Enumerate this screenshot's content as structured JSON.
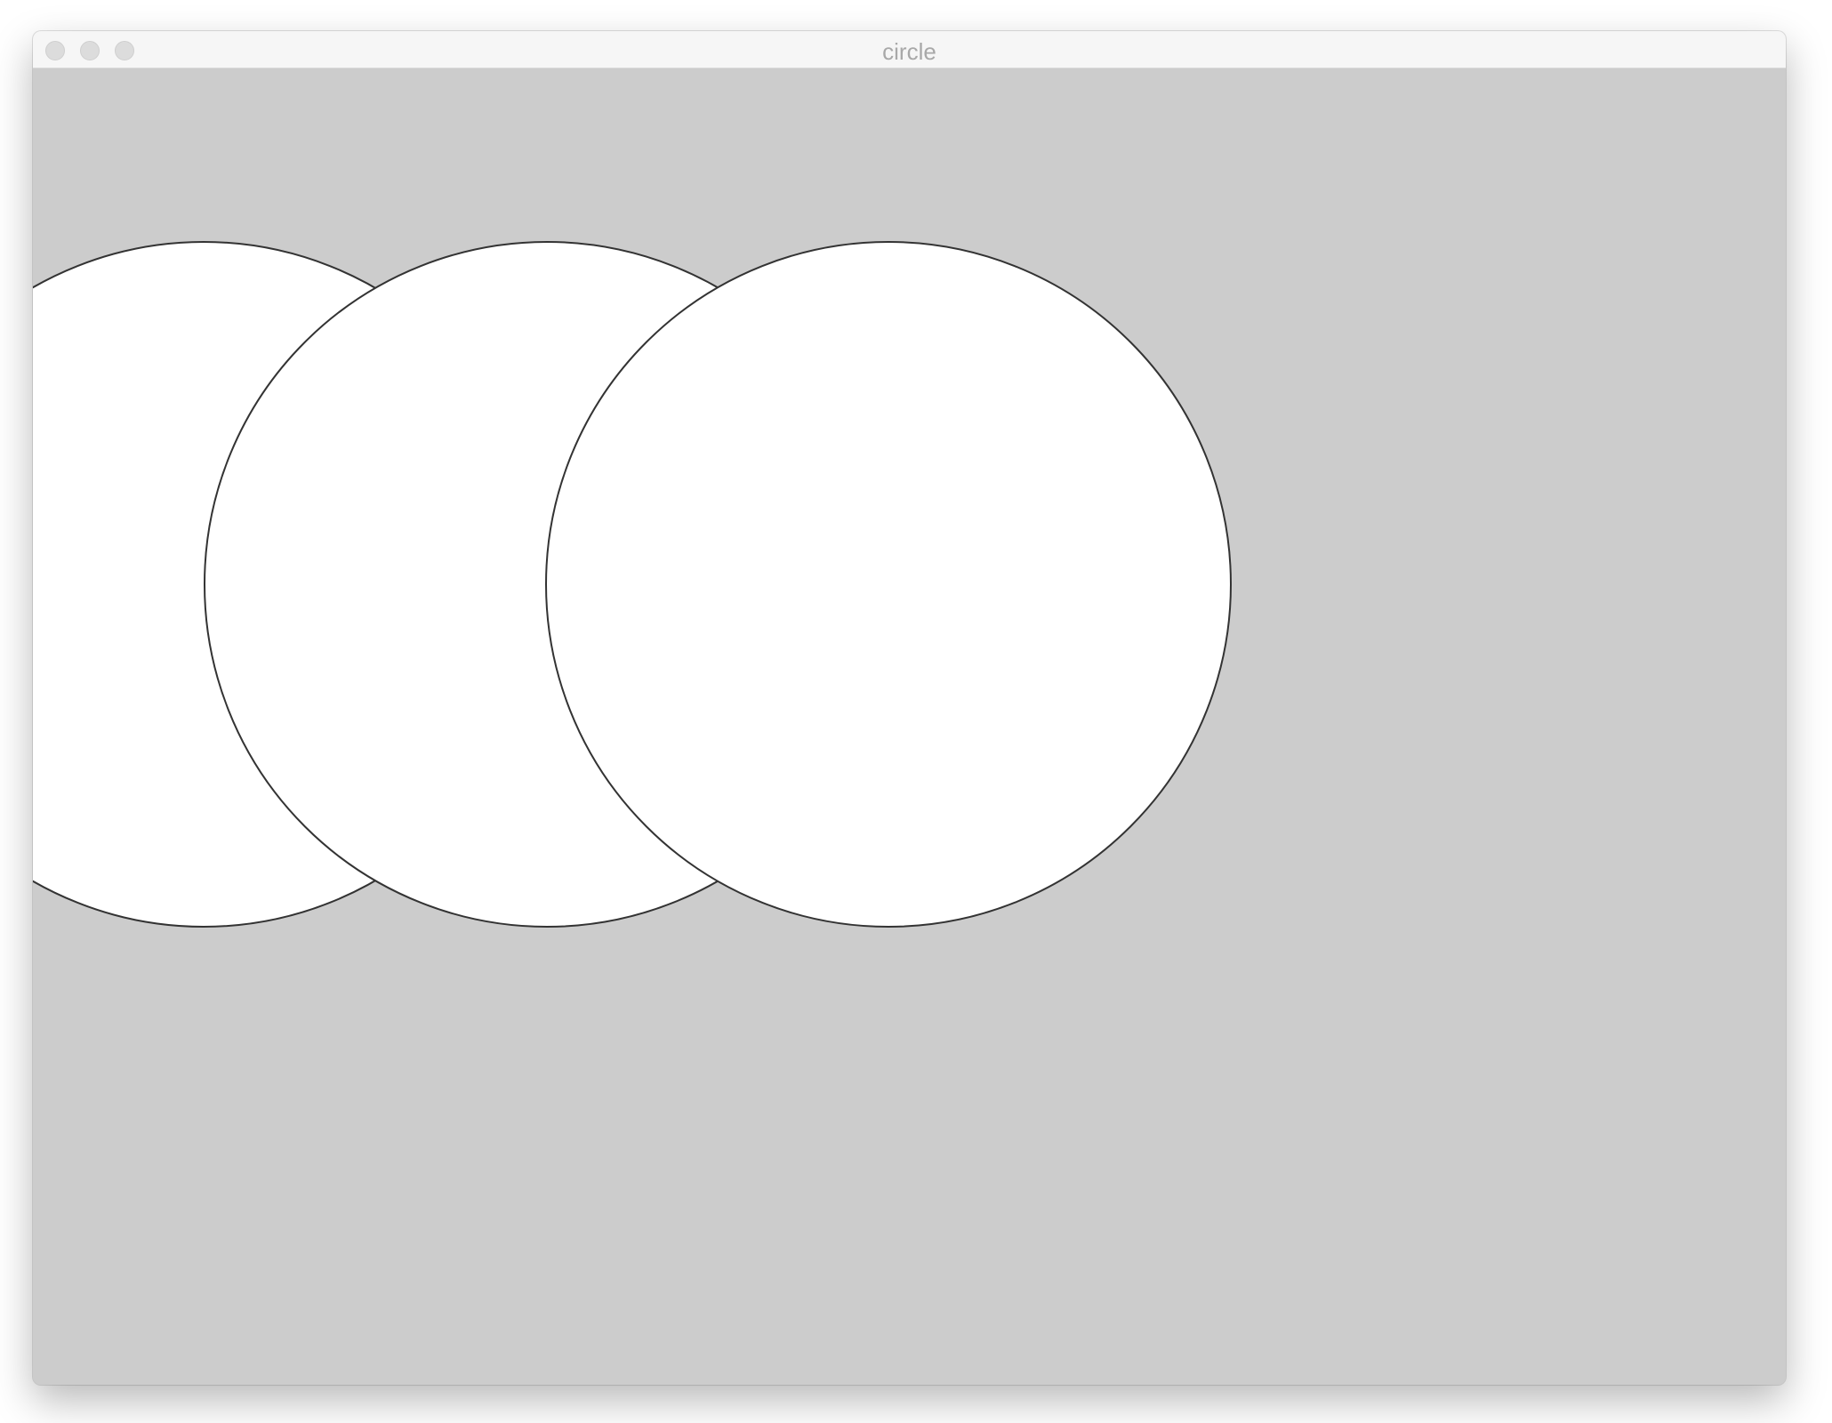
{
  "window": {
    "title": "circle",
    "buttons": [
      {
        "name": "close",
        "icon": "window-close-icon"
      },
      {
        "name": "minimize",
        "icon": "window-minimize-icon"
      },
      {
        "name": "zoom",
        "icon": "window-zoom-icon"
      }
    ]
  },
  "sketch": {
    "background_color": "#cccccc",
    "circle_fill": "#ffffff",
    "circle_stroke": "#000000",
    "circle_count": 3
  }
}
